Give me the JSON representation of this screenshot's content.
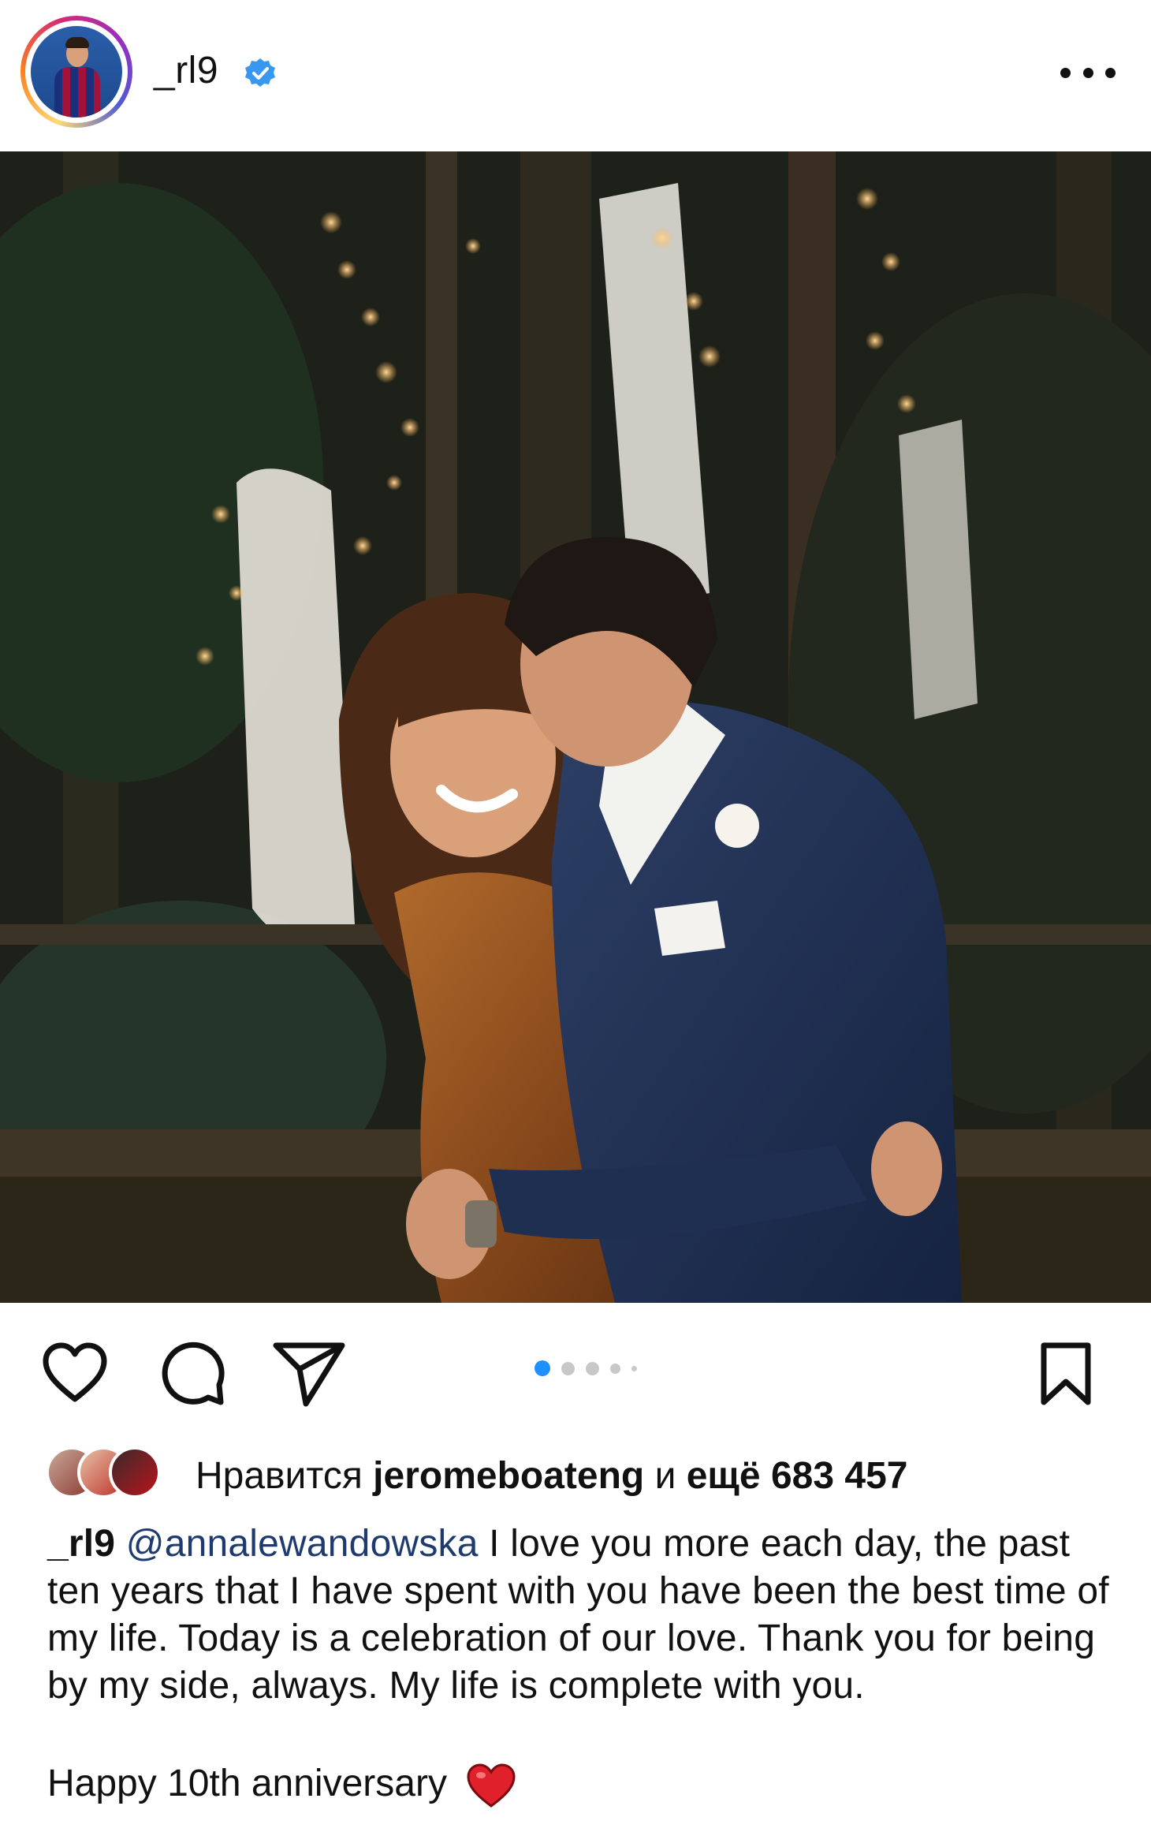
{
  "header": {
    "username": "_rl9",
    "verified_icon": "verified-badge-icon",
    "more_icon": "more-options-icon"
  },
  "post": {
    "image_alt": "couple embracing in a forest with string lights",
    "carousel": {
      "count": 5,
      "active_index": 0
    }
  },
  "actions": {
    "like_icon": "heart-icon",
    "comment_icon": "comment-icon",
    "share_icon": "send-icon",
    "save_icon": "bookmark-icon"
  },
  "likes": {
    "prefix": "Нравится",
    "user": "jeromeboateng",
    "connector": "и",
    "suffix": "ещё 683 457"
  },
  "caption": {
    "user": "_rl9",
    "mention": "@annalewandowska",
    "text": " I love you more each day, the past ten years that I have spent with you have been the best time of my life. Today is a celebration of our love. Thank you for being by my side, always. My life is complete with you.",
    "line2": "Happy 10th anniversary",
    "emoji": "red-heart-emoji"
  },
  "colors": {
    "accent_blue": "#1e90ff",
    "mention": "#1f3a6e",
    "heart_red": "#e0202a"
  }
}
